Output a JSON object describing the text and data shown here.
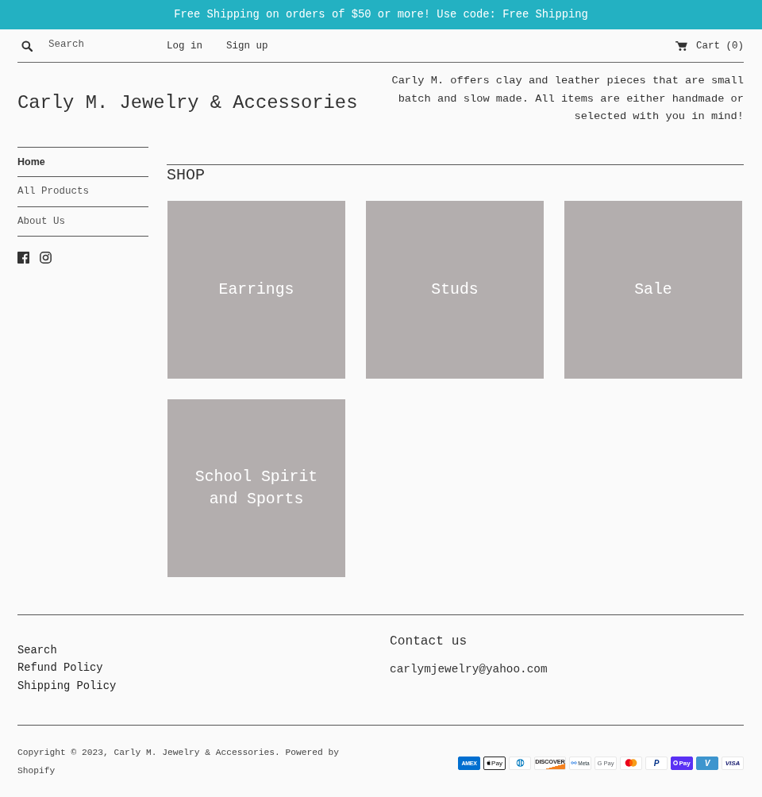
{
  "announcement": {
    "text": "Free Shipping on orders of $50 or more! Use code: Free Shipping"
  },
  "header": {
    "search": {
      "placeholder": "Search"
    },
    "account_links": [
      "Log in",
      "Sign up"
    ],
    "cart": {
      "label": "Cart (0)"
    }
  },
  "masthead": {
    "title": "Carly M. Jewelry & Accessories",
    "description": "Carly M. offers clay and leather pieces that are small batch and slow made. All items are either handmade or selected with you in mind!"
  },
  "sidebar": {
    "items": [
      {
        "label": "Home",
        "selected": true
      },
      {
        "label": "All Products",
        "selected": false
      },
      {
        "label": "About Us",
        "selected": false
      }
    ],
    "social": [
      {
        "kind": "facebook"
      },
      {
        "kind": "instagram"
      }
    ]
  },
  "shop": {
    "title": "SHOP",
    "collections": [
      {
        "title": "Earrings"
      },
      {
        "title": "Studs"
      },
      {
        "title": "Sale"
      },
      {
        "title": "School Spirit and Sports"
      }
    ]
  },
  "footer": {
    "links": [
      "Search",
      "Refund Policy",
      "Shipping Policy"
    ],
    "contact": {
      "heading": "Contact us",
      "email": "carlymjewelry@yahoo.com"
    },
    "copyright": "Copyright © 2023, Carly M. Jewelry & Accessories. Powered by Shopify",
    "payment_icons": [
      {
        "kind": "amex",
        "label": "AMEX"
      },
      {
        "kind": "apple_pay",
        "label": "Pay"
      },
      {
        "kind": "diners"
      },
      {
        "kind": "discover",
        "label": "DISCOVER"
      },
      {
        "kind": "meta_pay",
        "label": "Meta"
      },
      {
        "kind": "google_pay",
        "label": "G Pay"
      },
      {
        "kind": "mastercard"
      },
      {
        "kind": "paypal",
        "label": "P"
      },
      {
        "kind": "shop_pay",
        "label": "Pay"
      },
      {
        "kind": "venmo",
        "label": "V"
      },
      {
        "kind": "visa",
        "label": "VISA"
      }
    ]
  }
}
